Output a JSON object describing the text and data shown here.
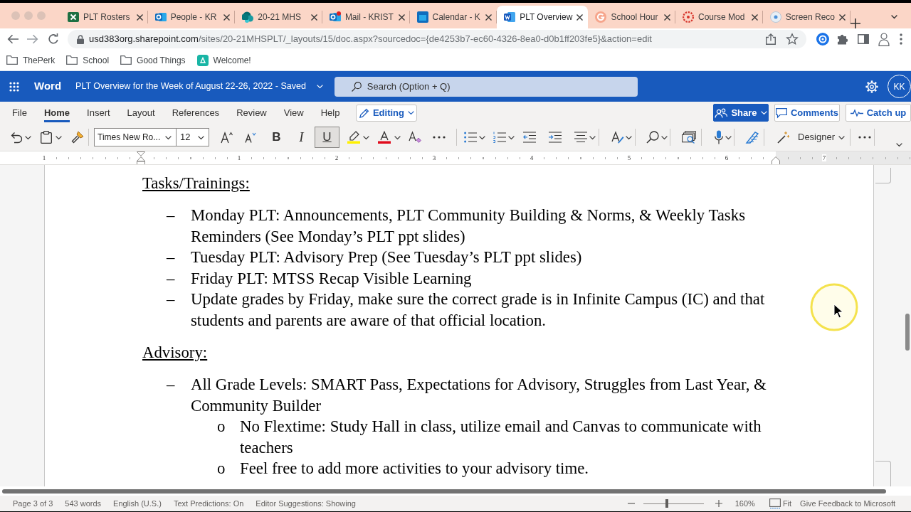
{
  "browser": {
    "tabs": [
      {
        "title": "PLT Rosters",
        "kind": "sheet",
        "selected": false
      },
      {
        "title": "People - KR",
        "kind": "mail",
        "selected": false
      },
      {
        "title": "20-21 MHS",
        "kind": "site",
        "selected": false
      },
      {
        "title": "Mail - KRIST",
        "kind": "mail-alert",
        "selected": false
      },
      {
        "title": "Calendar - K",
        "kind": "calendar",
        "selected": false
      },
      {
        "title": "PLT Overview",
        "kind": "doc",
        "selected": true
      },
      {
        "title": "School Hour",
        "kind": "g-letter",
        "selected": false
      },
      {
        "title": "Course Mod",
        "kind": "ring",
        "selected": false
      },
      {
        "title": "Screen Reco",
        "kind": "record",
        "selected": false
      }
    ],
    "address": {
      "host": "usd383org.sharepoint.com",
      "path": "/sites/20-21MHSPLT/_layouts/15/doc.aspx?sourcedoc={de4253b7-ec60-4326-8ea0-d0b1ff203fe5}&action=edit"
    },
    "bookmarks": [
      {
        "label": "ThePerk",
        "kind": "folder"
      },
      {
        "label": "School",
        "kind": "folder"
      },
      {
        "label": "Good Things",
        "kind": "folder"
      },
      {
        "label": "Welcome!",
        "kind": "app"
      }
    ]
  },
  "word": {
    "app_name": "Word",
    "title": "PLT Overview for the Week of August 22-26, 2022 - Saved",
    "search": {
      "placeholder": "Search (Option + Q)"
    },
    "user_initials": "KK",
    "ribbon_tabs": [
      {
        "label": "File",
        "selected": false
      },
      {
        "label": "Home",
        "selected": true
      },
      {
        "label": "Insert",
        "selected": false
      },
      {
        "label": "Layout",
        "selected": false
      },
      {
        "label": "References",
        "selected": false
      },
      {
        "label": "Review",
        "selected": false
      },
      {
        "label": "View",
        "selected": false
      },
      {
        "label": "Help",
        "selected": false
      }
    ],
    "mode": "Editing",
    "actions": [
      {
        "label": "Share",
        "kind": "primary"
      },
      {
        "label": "Comments",
        "kind": "plain"
      },
      {
        "label": "Catch up",
        "kind": "plain"
      }
    ],
    "font_name": "Times New Ro...",
    "font_size": "12",
    "format_buttons": [
      {
        "label": "B",
        "kind": "bold",
        "selected": false
      },
      {
        "label": "I",
        "kind": "italic",
        "selected": false
      },
      {
        "label": "U",
        "kind": "underline",
        "selected": true
      }
    ],
    "designer": "Designer",
    "ruler_numbers": [
      "1",
      "1",
      "2",
      "3",
      "4",
      "5",
      "6",
      "7"
    ]
  },
  "document": {
    "sections": [
      {
        "heading": "Tasks/Trainings:",
        "items": [
          {
            "bullet": "–",
            "text": "Monday PLT: Announcements, PLT Community Building & Norms, & Weekly Tasks Reminders (See Monday’s PLT ppt slides)"
          },
          {
            "bullet": "–",
            "text": "Tuesday PLT: Advisory Prep (See Tuesday’s PLT ppt slides)"
          },
          {
            "bullet": "–",
            "text": "Friday PLT: MTSS Recap Visible Learning"
          },
          {
            "bullet": "–",
            "text": "Update grades by Friday, make sure the correct grade is in Infinite Campus (IC) and that students and parents are aware of that official location."
          }
        ]
      },
      {
        "heading": "Advisory:",
        "items": [
          {
            "bullet": "–",
            "text": "All Grade Levels: SMART Pass, Expectations for Advisory, Struggles from Last Year, & Community Builder",
            "children": [
              {
                "bullet": "o",
                "text": "No Flextime: Study Hall in class, utilize email and Canvas to communicate with teachers"
              },
              {
                "bullet": "o",
                "text": "Feel free to add more activities to your advisory time."
              }
            ]
          }
        ]
      }
    ]
  },
  "status_bar": {
    "items": [
      "Page 3 of 3",
      "543 words",
      "English (U.S.)",
      "Text Predictions: On",
      "Editor Suggestions: Showing"
    ],
    "zoom": {
      "level": 0.38,
      "reading": "160%"
    },
    "fit": "Fit",
    "feedback": "Give Feedback to Microsoft"
  }
}
